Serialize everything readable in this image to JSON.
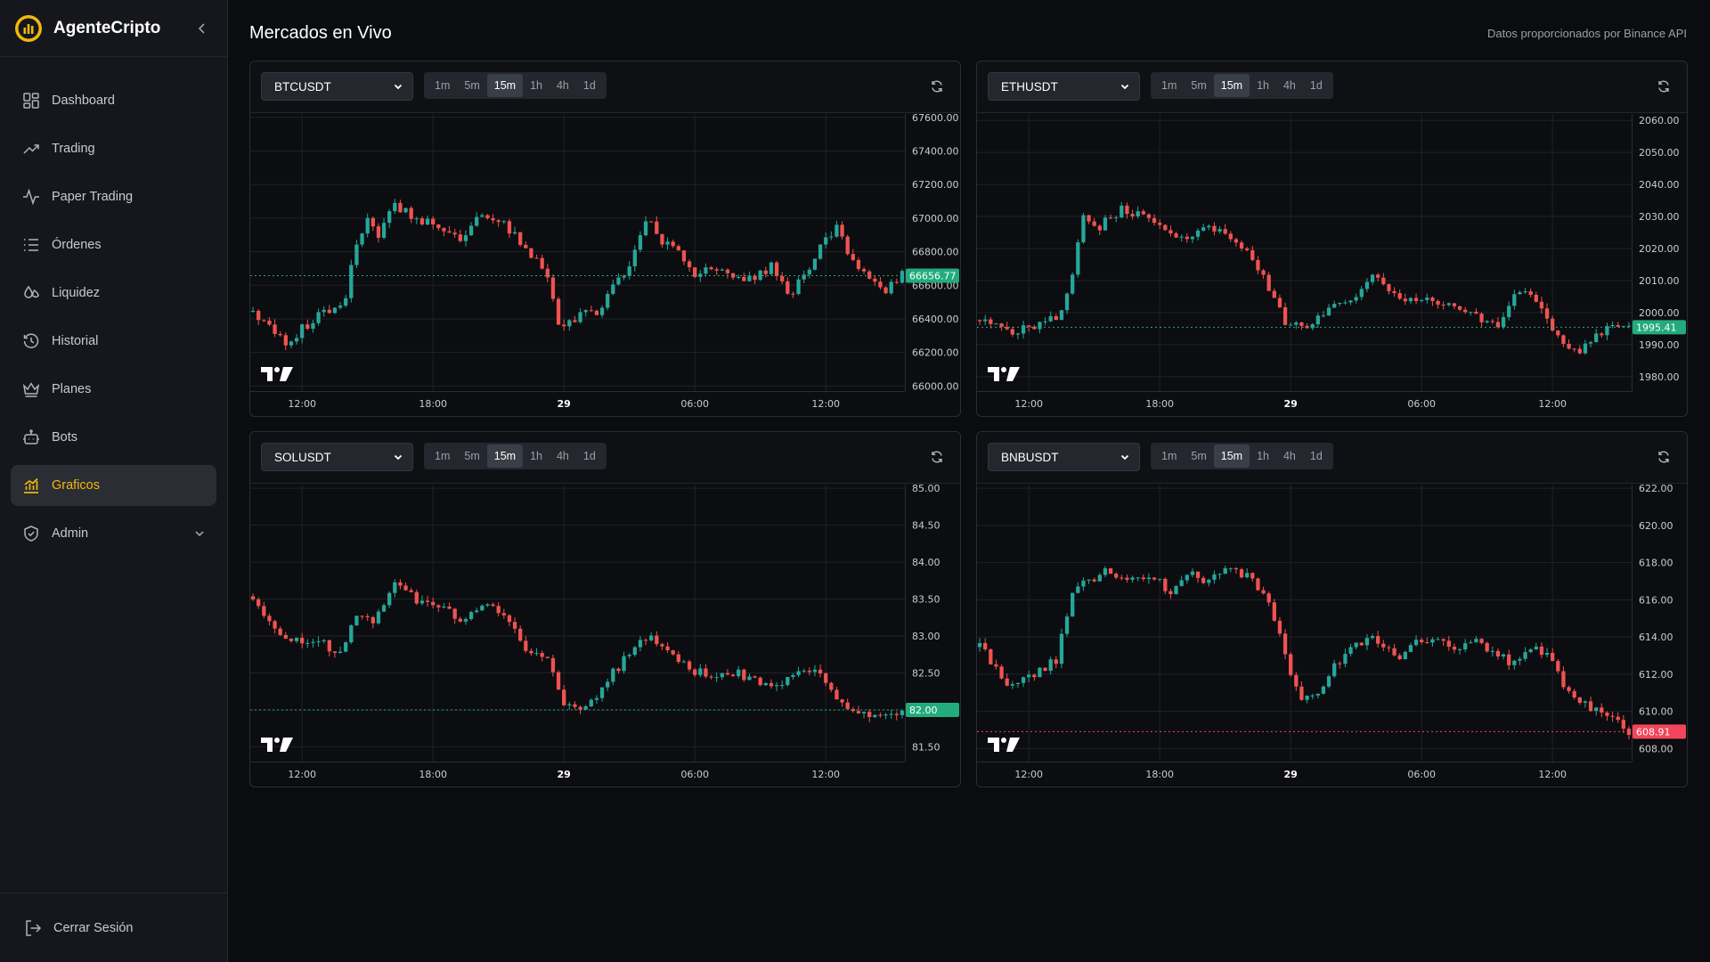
{
  "app": {
    "name": "AgenteCripto"
  },
  "sidebar": {
    "items": [
      {
        "label": "Dashboard",
        "icon": "dashboard-icon"
      },
      {
        "label": "Trading",
        "icon": "trending-up-icon"
      },
      {
        "label": "Paper Trading",
        "icon": "activity-icon"
      },
      {
        "label": "Órdenes",
        "icon": "list-icon"
      },
      {
        "label": "Liquidez",
        "icon": "droplets-icon"
      },
      {
        "label": "Historial",
        "icon": "history-icon"
      },
      {
        "label": "Planes",
        "icon": "crown-icon"
      },
      {
        "label": "Bots",
        "icon": "bot-icon"
      },
      {
        "label": "Graficos",
        "icon": "bar-chart-icon",
        "active": true
      },
      {
        "label": "Admin",
        "icon": "shield-icon",
        "has_submenu": true
      }
    ],
    "logout_label": "Cerrar Sesión"
  },
  "header": {
    "title": "Mercados en Vivo",
    "source_note": "Datos proporcionados por Binance API"
  },
  "colors": {
    "up": "#26a69a",
    "down": "#ef5350",
    "accent": "#f0b90b",
    "up_tag": "#22ab7d",
    "down_tag": "#f2455d"
  },
  "interval_options": [
    "1m",
    "5m",
    "15m",
    "1h",
    "4h",
    "1d"
  ],
  "active_interval": "15m",
  "x_tick_labels": [
    "12:00",
    "18:00",
    "29",
    "06:00",
    "12:00"
  ],
  "chart_data": [
    {
      "type": "candlestick",
      "symbol": "BTCUSDT",
      "interval": "15m",
      "y_ticks": [
        "66000.00",
        "66200.00",
        "66400.00",
        "66600.00",
        "66800.00",
        "67000.00",
        "67200.00",
        "67400.00",
        "67600.00"
      ],
      "ylim": [
        65970,
        67620
      ],
      "last_price": 66656.77,
      "last_price_label": "66656.77",
      "direction": "up",
      "x_tick_labels": [
        "12:00",
        "18:00",
        "29",
        "06:00",
        "12:00"
      ],
      "close_path": [
        [
          0,
          66450
        ],
        [
          6,
          66260
        ],
        [
          12,
          66420
        ],
        [
          17,
          66520
        ],
        [
          19,
          66870
        ],
        [
          21,
          66990
        ],
        [
          23,
          66880
        ],
        [
          26,
          67080
        ],
        [
          30,
          67000
        ],
        [
          34,
          66960
        ],
        [
          38,
          66880
        ],
        [
          42,
          67020
        ],
        [
          46,
          66960
        ],
        [
          50,
          66820
        ],
        [
          54,
          66660
        ],
        [
          56,
          66340
        ],
        [
          60,
          66420
        ],
        [
          63,
          66440
        ],
        [
          66,
          66590
        ],
        [
          69,
          66700
        ],
        [
          72,
          67000
        ],
        [
          75,
          66860
        ],
        [
          78,
          66820
        ],
        [
          81,
          66640
        ],
        [
          84,
          66700
        ],
        [
          88,
          66650
        ],
        [
          92,
          66640
        ],
        [
          95,
          66720
        ],
        [
          98,
          66540
        ],
        [
          101,
          66640
        ],
        [
          104,
          66850
        ],
        [
          107,
          66940
        ],
        [
          110,
          66740
        ],
        [
          113,
          66640
        ],
        [
          116,
          66560
        ],
        [
          119,
          66660
        ]
      ],
      "y_range": [
        66000,
        67600
      ]
    },
    {
      "type": "candlestick",
      "symbol": "ETHUSDT",
      "interval": "15m",
      "y_ticks": [
        "1980.00",
        "1990.00",
        "2000.00",
        "2010.00",
        "2020.00",
        "2030.00",
        "2040.00",
        "2050.00",
        "2060.00"
      ],
      "ylim": [
        1975.5,
        2062
      ],
      "last_price": 1995.41,
      "last_price_label": "1995.41",
      "direction": "up",
      "x_tick_labels": [
        "12:00",
        "18:00",
        "29",
        "06:00",
        "12:00"
      ],
      "close_path": [
        [
          0,
          1998
        ],
        [
          6,
          1994
        ],
        [
          12,
          1997
        ],
        [
          15,
          2000
        ],
        [
          17,
          2012
        ],
        [
          19,
          2030
        ],
        [
          22,
          2027
        ],
        [
          26,
          2032
        ],
        [
          30,
          2030
        ],
        [
          34,
          2025
        ],
        [
          38,
          2024
        ],
        [
          42,
          2027
        ],
        [
          46,
          2024
        ],
        [
          50,
          2017
        ],
        [
          53,
          2008
        ],
        [
          56,
          1997
        ],
        [
          60,
          1996
        ],
        [
          63,
          2000
        ],
        [
          66,
          2002
        ],
        [
          69,
          2006
        ],
        [
          72,
          2013
        ],
        [
          75,
          2007
        ],
        [
          78,
          2003
        ],
        [
          81,
          2004
        ],
        [
          85,
          2003
        ],
        [
          89,
          2001
        ],
        [
          92,
          1998
        ],
        [
          95,
          1995
        ],
        [
          98,
          2005
        ],
        [
          101,
          2006
        ],
        [
          104,
          1999
        ],
        [
          107,
          1989
        ],
        [
          110,
          1987
        ],
        [
          113,
          1994
        ],
        [
          116,
          1995
        ],
        [
          119,
          1995.4
        ]
      ],
      "y_range": [
        1980,
        2060
      ]
    },
    {
      "type": "candlestick",
      "symbol": "SOLUSDT",
      "interval": "15m",
      "y_ticks": [
        "81.50",
        "82.00",
        "82.50",
        "83.00",
        "83.50",
        "84.00",
        "84.50",
        "85.00"
      ],
      "ylim": [
        81.3,
        85.05
      ],
      "last_price": 82.0,
      "last_price_label": "82.00",
      "direction": "up",
      "x_tick_labels": [
        "12:00",
        "18:00",
        "29",
        "06:00",
        "12:00"
      ],
      "close_path": [
        [
          0,
          83.55
        ],
        [
          4,
          83.05
        ],
        [
          8,
          82.95
        ],
        [
          12,
          82.95
        ],
        [
          16,
          82.75
        ],
        [
          19,
          83.3
        ],
        [
          22,
          83.2
        ],
        [
          26,
          83.75
        ],
        [
          30,
          83.5
        ],
        [
          34,
          83.4
        ],
        [
          38,
          83.25
        ],
        [
          42,
          83.4
        ],
        [
          46,
          83.3
        ],
        [
          50,
          82.85
        ],
        [
          54,
          82.65
        ],
        [
          57,
          82.1
        ],
        [
          60,
          82.0
        ],
        [
          63,
          82.2
        ],
        [
          66,
          82.5
        ],
        [
          69,
          82.75
        ],
        [
          72,
          83.0
        ],
        [
          75,
          82.85
        ],
        [
          78,
          82.7
        ],
        [
          81,
          82.5
        ],
        [
          85,
          82.5
        ],
        [
          89,
          82.5
        ],
        [
          93,
          82.35
        ],
        [
          96,
          82.3
        ],
        [
          100,
          82.5
        ],
        [
          103,
          82.5
        ],
        [
          106,
          82.3
        ],
        [
          109,
          82.0
        ],
        [
          112,
          81.95
        ],
        [
          116,
          81.95
        ],
        [
          119,
          82.0
        ]
      ],
      "y_range": [
        81.5,
        85.0
      ]
    },
    {
      "type": "candlestick",
      "symbol": "BNBUSDT",
      "interval": "15m",
      "y_ticks": [
        "608.00",
        "610.00",
        "612.00",
        "614.00",
        "616.00",
        "618.00",
        "620.00",
        "622.00"
      ],
      "ylim": [
        607.3,
        622.2
      ],
      "last_price": 608.91,
      "last_price_label": "608.91",
      "direction": "down",
      "x_tick_labels": [
        "12:00",
        "18:00",
        "29",
        "06:00",
        "12:00"
      ],
      "close_path": [
        [
          0,
          613.5
        ],
        [
          5,
          611.5
        ],
        [
          10,
          612.0
        ],
        [
          14,
          612.8
        ],
        [
          17,
          616.5
        ],
        [
          20,
          617.0
        ],
        [
          23,
          617.5
        ],
        [
          27,
          617.0
        ],
        [
          31,
          617.3
        ],
        [
          35,
          616.5
        ],
        [
          39,
          617.3
        ],
        [
          42,
          617.0
        ],
        [
          45,
          617.8
        ],
        [
          49,
          617.3
        ],
        [
          53,
          616.0
        ],
        [
          56,
          613.0
        ],
        [
          59,
          610.5
        ],
        [
          62,
          611.0
        ],
        [
          65,
          612.5
        ],
        [
          68,
          613.3
        ],
        [
          71,
          614.0
        ],
        [
          74,
          613.5
        ],
        [
          77,
          612.8
        ],
        [
          80,
          614.0
        ],
        [
          83,
          613.8
        ],
        [
          87,
          613.5
        ],
        [
          91,
          613.8
        ],
        [
          95,
          613.0
        ],
        [
          98,
          612.5
        ],
        [
          101,
          613.5
        ],
        [
          104,
          613.0
        ],
        [
          107,
          611.5
        ],
        [
          110,
          610.5
        ],
        [
          113,
          610.0
        ],
        [
          116,
          609.5
        ],
        [
          119,
          608.91
        ]
      ],
      "y_range": [
        608,
        622
      ]
    }
  ]
}
